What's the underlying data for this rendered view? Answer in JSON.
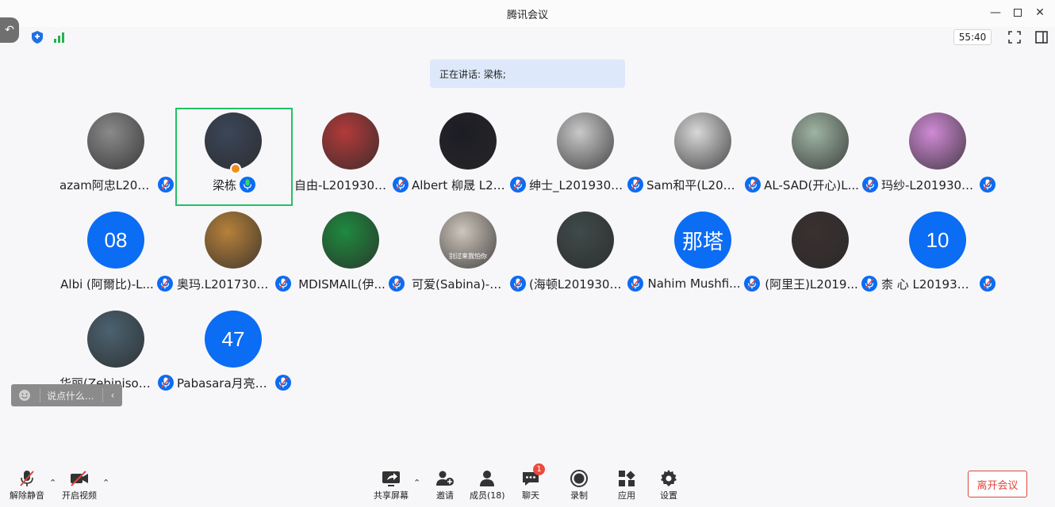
{
  "window": {
    "title": "腾讯会议",
    "timer": "55:40"
  },
  "speaking": {
    "text": "正在讲话: 梁栋;"
  },
  "participants": [
    {
      "name": "azam阿忠L2019300...",
      "avatar": "photo",
      "color": "#8a8a8a"
    },
    {
      "name": "梁栋",
      "avatar": "photo",
      "color": "#3b4658",
      "active": true
    },
    {
      "name": "自由-L2019300...",
      "avatar": "photo",
      "color": "#b23a3a"
    },
    {
      "name": "Albert 柳晟 L20...",
      "avatar": "photo",
      "color": "#1c1c24"
    },
    {
      "name": "绅士_L2019300...",
      "avatar": "photo",
      "color": "#c9c9c9"
    },
    {
      "name": "Sam和平(L2019...",
      "avatar": "photo",
      "color": "#d8d8d8"
    },
    {
      "name": "AL-SAD(开心)L...",
      "avatar": "photo",
      "color": "#9fb4a3"
    },
    {
      "name": "玛纱-L201930023-...",
      "avatar": "photo",
      "color": "#d08ad6"
    },
    {
      "name": "Albi (阿爾比)-L...",
      "avatar": "text",
      "label": "08"
    },
    {
      "name": "奥玛.L2017300...",
      "avatar": "photo",
      "color": "#b7813a"
    },
    {
      "name": "MDISMAIL(伊...",
      "avatar": "photo",
      "color": "#1f8a3e"
    },
    {
      "name": "可爱(Sabina)-L...",
      "avatar": "photo",
      "color": "#cfc6bc",
      "caption": "别过来我怕你"
    },
    {
      "name": "(海顿L201930006...",
      "avatar": "photo",
      "color": "#3f4a4a"
    },
    {
      "name": "Nahim Mushfi...",
      "avatar": "text",
      "label": "那塔"
    },
    {
      "name": "(阿里王)L2019...",
      "avatar": "photo",
      "color": "#3a3030"
    },
    {
      "name": "柰 心 L2019300...",
      "avatar": "text",
      "label": "10"
    },
    {
      "name": "华丽(Zebiniso)-...",
      "avatar": "photo",
      "color": "#4b6270"
    },
    {
      "name": "Pabasara月亮L...",
      "avatar": "text",
      "label": "47"
    }
  ],
  "chat": {
    "placeholder": "说点什么..."
  },
  "bottom": {
    "unmute": "解除静音",
    "video": "开启视频",
    "share": "共享屏幕",
    "invite": "邀请",
    "members": "成员(18)",
    "chat": "聊天",
    "chat_badge": "1",
    "record": "录制",
    "apps": "应用",
    "settings": "设置",
    "leave": "离开会议"
  },
  "colors": {
    "accent": "#0b6cf4",
    "active_border": "#21c262",
    "leave": "#e0463f"
  }
}
